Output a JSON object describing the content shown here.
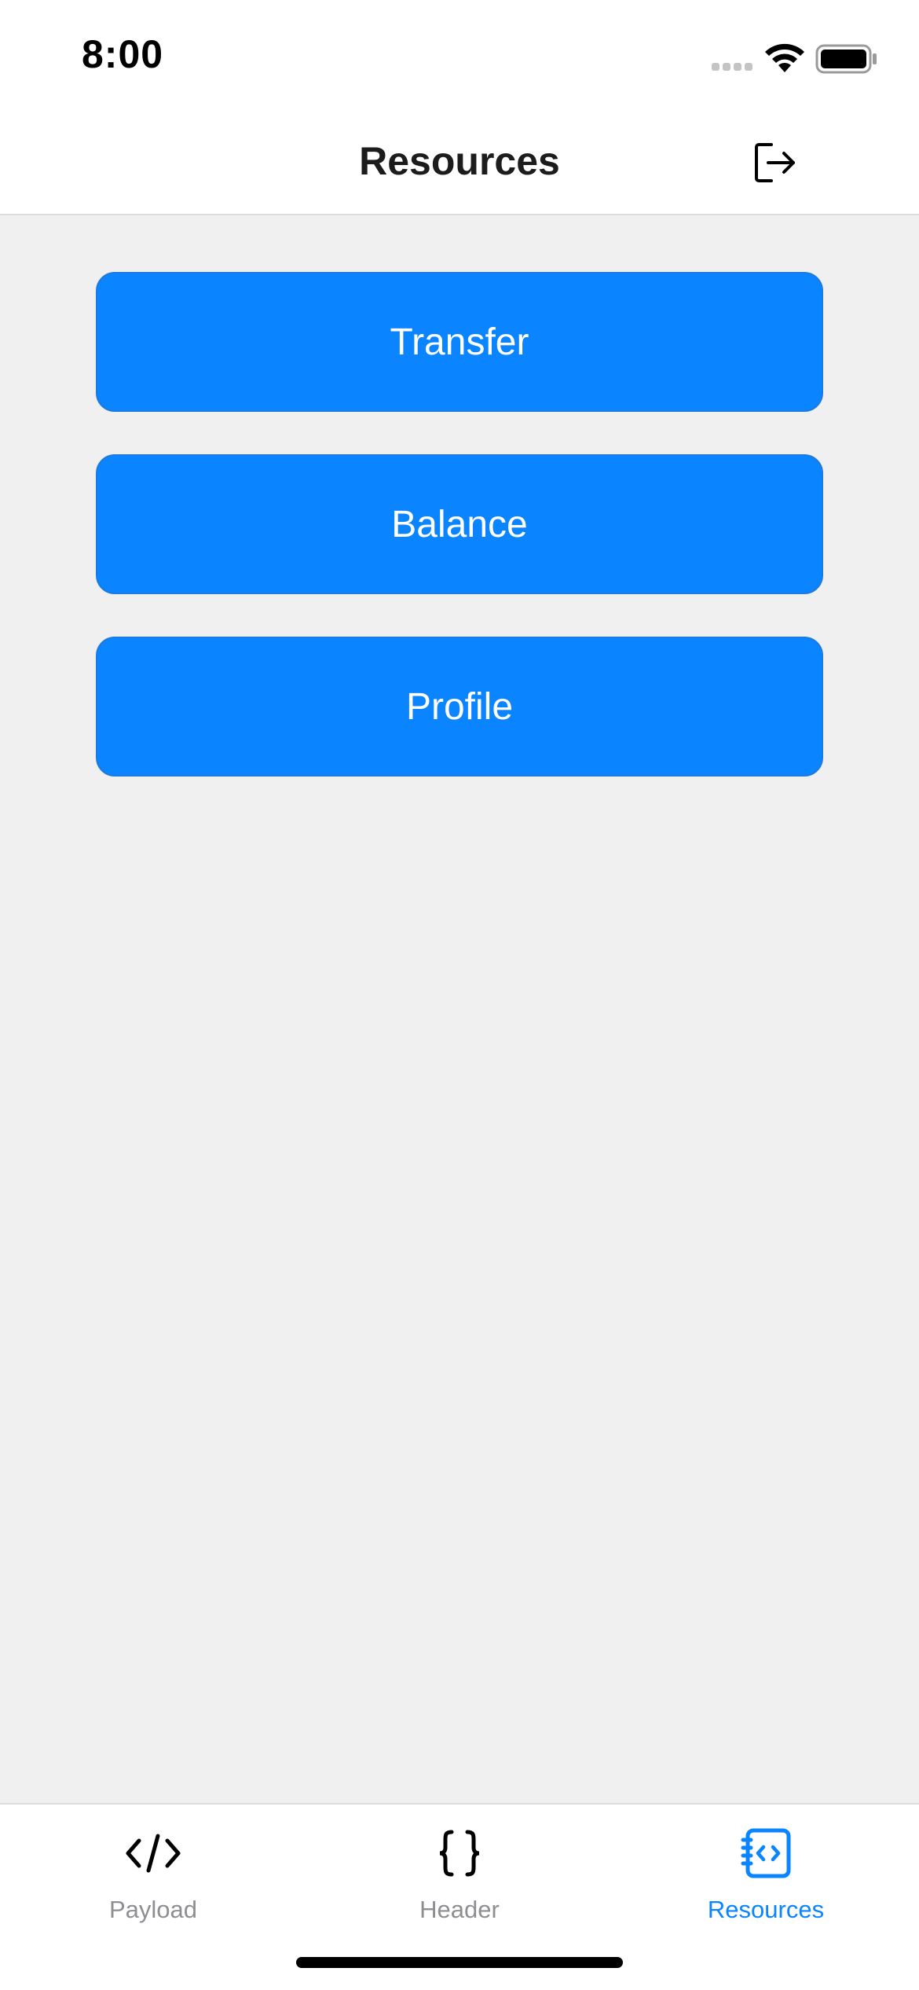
{
  "status_bar": {
    "time": "8:00"
  },
  "nav": {
    "title": "Resources",
    "logout_icon": "logout-icon"
  },
  "buttons": [
    {
      "label": "Transfer"
    },
    {
      "label": "Balance"
    },
    {
      "label": "Profile"
    }
  ],
  "tabs": [
    {
      "label": "Payload",
      "icon": "code-icon",
      "active": false
    },
    {
      "label": "Header",
      "icon": "braces-icon",
      "active": false
    },
    {
      "label": "Resources",
      "icon": "resources-icon",
      "active": true
    }
  ],
  "colors": {
    "accent": "#0a84ff",
    "background": "#f0f0f0",
    "inactive_tab": "#8e8e93"
  }
}
